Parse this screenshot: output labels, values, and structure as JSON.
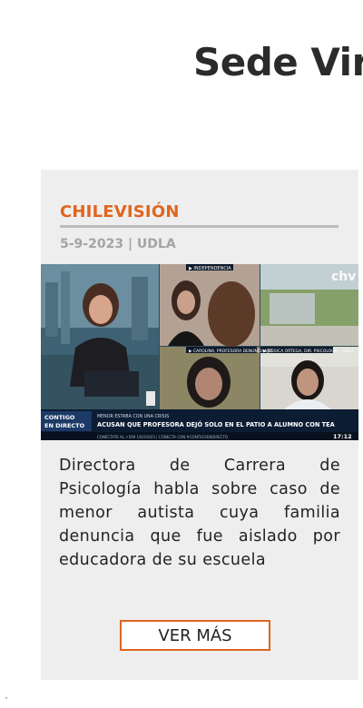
{
  "header": {
    "title": "Sede Vir"
  },
  "card": {
    "source": "CHILEVISIÓN",
    "date": "5-9-2023 | UDLA",
    "description": "Directora de Carrera de Psicología habla sobre caso de menor autista cuya familia denuncia que fue aislado por educadora de su escuela",
    "cta_label": "VER MÁS",
    "thumbnail": {
      "tags": [
        "INDEPENDENCIA",
        "CAROLINA, PROFESORA DENUNCIANTE",
        "JESSICA ORTEGA, DIR. PSICOLOGÍA · UDLA"
      ],
      "show_badge": "CONTIGO EN DIRECTO",
      "kicker": "MENOR ESTABA CON UNA CRISIS",
      "headline": "ACUSAN QUE PROFESORA DEJÓ SOLO EN EL PATIO A ALUMNO CON TEA",
      "ticker": "CONÉCTATE AL +569 19191923 | CONECTA CON #CONTIGOENDIRECTO",
      "clock": "17:12",
      "network_logo": "chv"
    }
  },
  "colors": {
    "accent": "#e0651e",
    "card_bg": "#eeeeef",
    "title": "#2b2b2b"
  }
}
